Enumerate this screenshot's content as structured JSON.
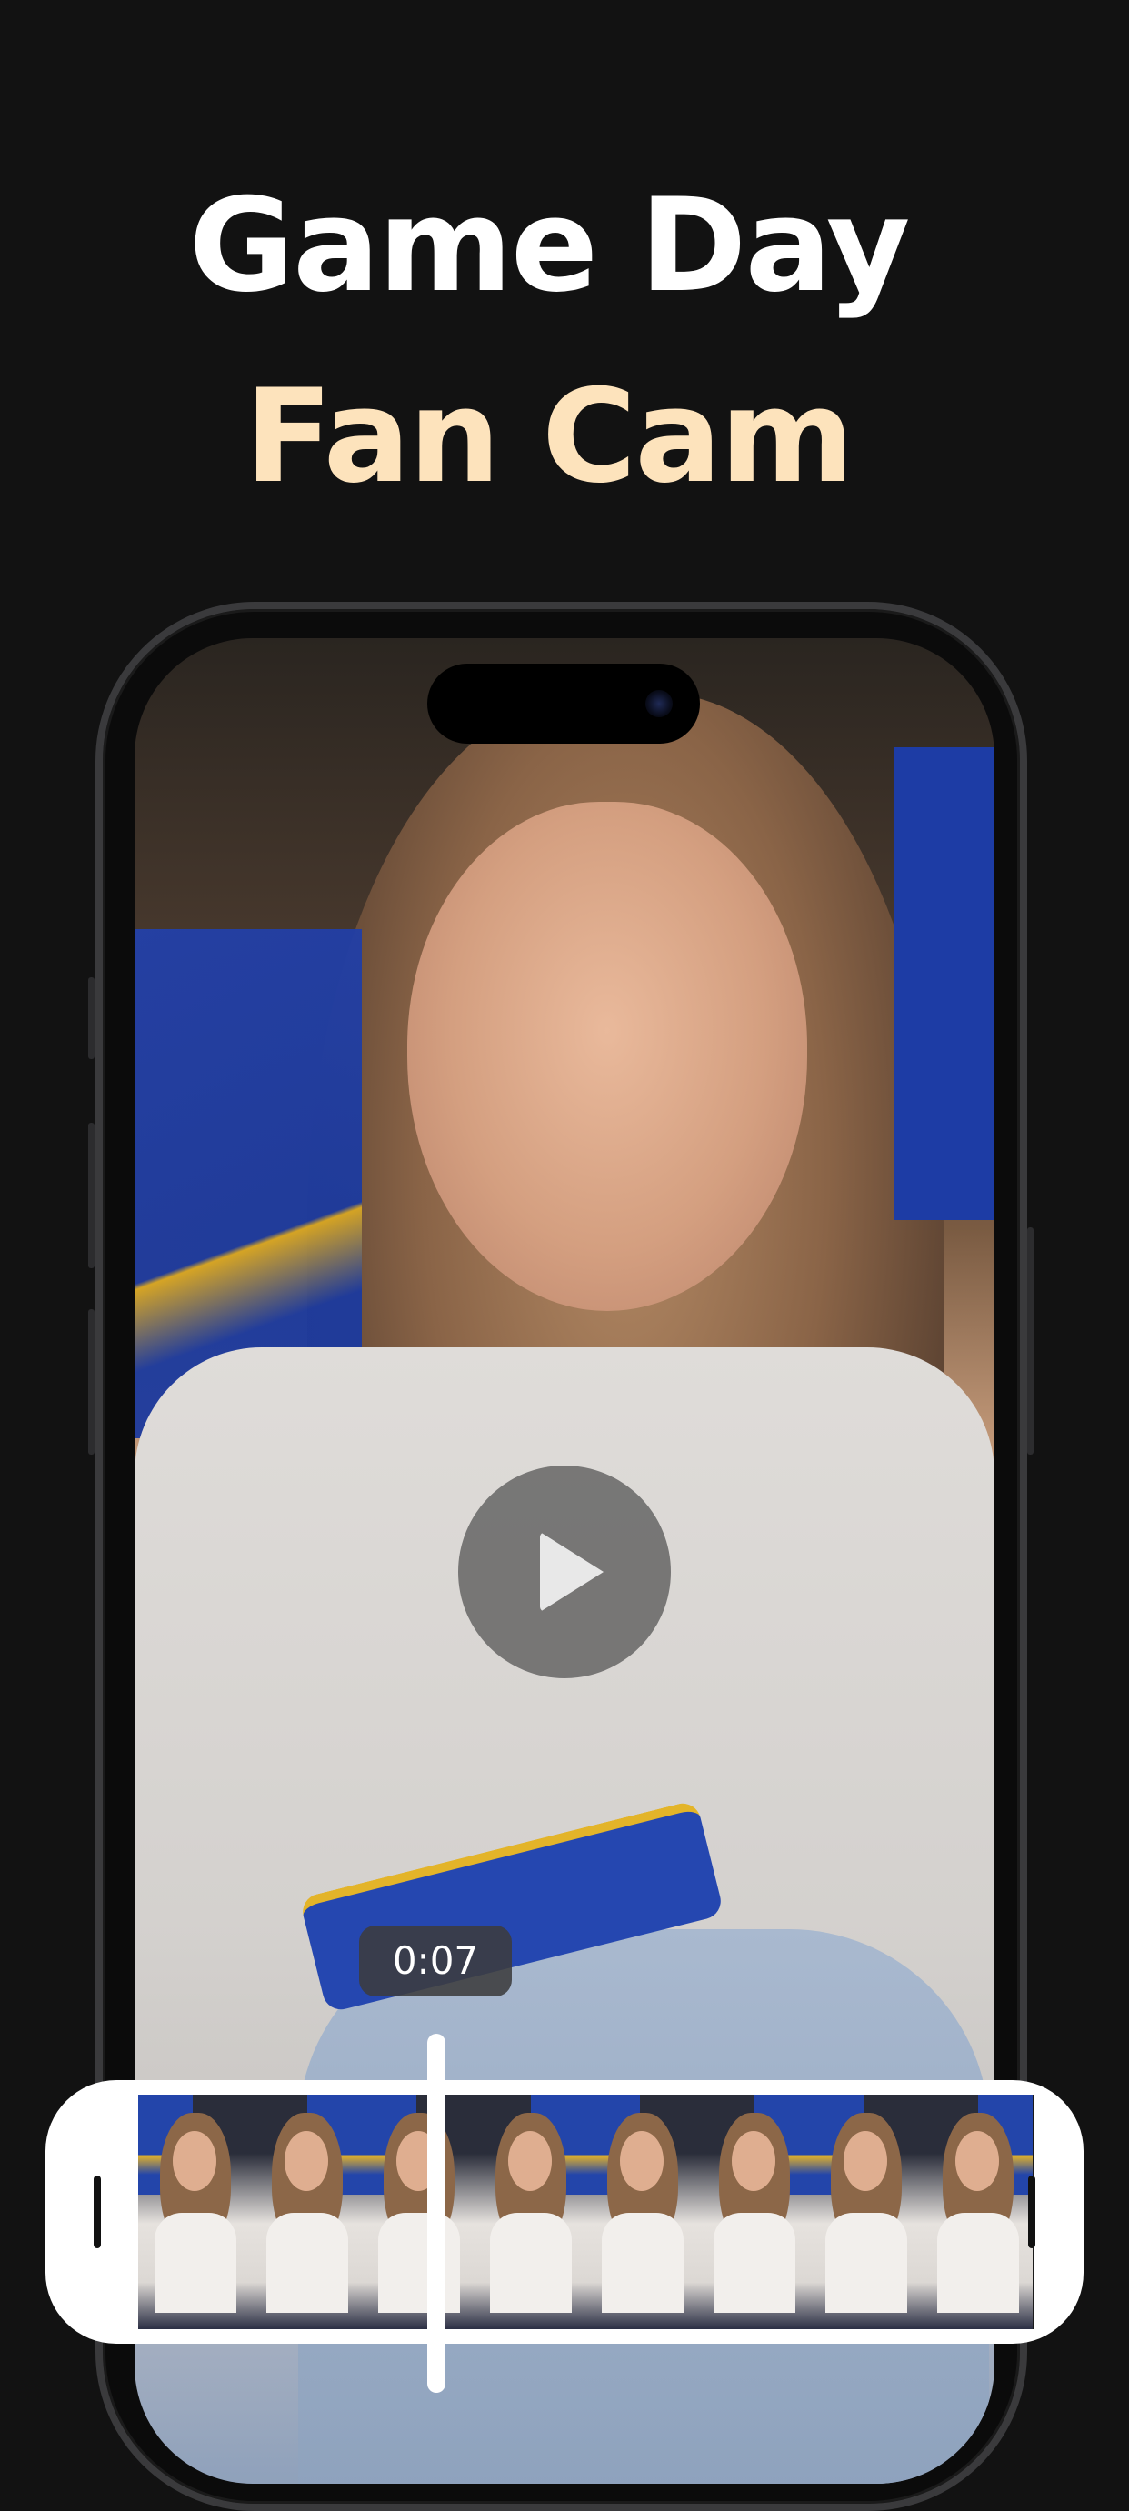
{
  "headline": {
    "line1": "Game Day",
    "line2": "Fan Cam"
  },
  "colors": {
    "background": "#121212",
    "headline_primary": "#ffffff",
    "headline_accent": "#fde3bc",
    "timeline_frame": "#ffffff"
  },
  "player": {
    "play_icon": "play-icon",
    "timestamp": "0:07"
  },
  "timeline": {
    "frame_count": 8,
    "handles": [
      "trim-start-handle",
      "trim-end-handle"
    ],
    "playhead_icon": "playhead"
  }
}
